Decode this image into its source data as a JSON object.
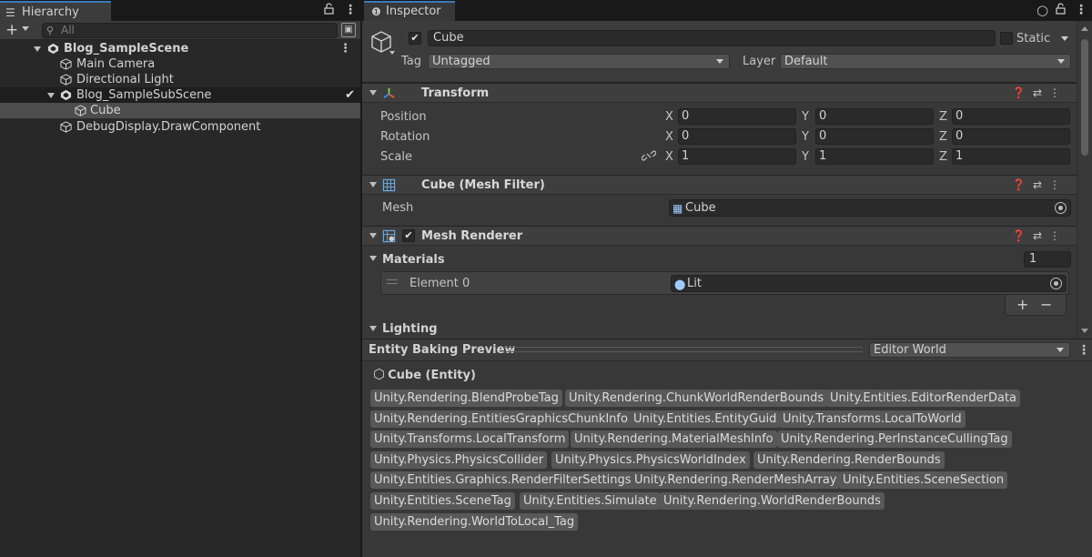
{
  "hierarchy": {
    "tab_label": "Hierarchy",
    "search_placeholder": "All",
    "items": [
      {
        "label": "Blog_SampleScene",
        "kind": "scene"
      },
      {
        "label": "Main Camera",
        "kind": "gameobject"
      },
      {
        "label": "Directional Light",
        "kind": "gameobject"
      },
      {
        "label": "Blog_SampleSubScene",
        "kind": "subscene"
      },
      {
        "label": "Cube",
        "kind": "gameobject",
        "selected": true
      },
      {
        "label": "DebugDisplay.DrawComponent",
        "kind": "gameobject"
      }
    ]
  },
  "inspector": {
    "tab_label": "Inspector",
    "object_name": "Cube",
    "static_label": "Static",
    "tag_label": "Tag",
    "tag_value": "Untagged",
    "layer_label": "Layer",
    "layer_value": "Default"
  },
  "transform": {
    "title": "Transform",
    "rows": [
      {
        "label": "Position",
        "x": "0",
        "y": "0",
        "z": "0"
      },
      {
        "label": "Rotation",
        "x": "0",
        "y": "0",
        "z": "0"
      },
      {
        "label": "Scale",
        "x": "1",
        "y": "1",
        "z": "1"
      }
    ],
    "axis_x": "X",
    "axis_y": "Y",
    "axis_z": "Z"
  },
  "mesh_filter": {
    "title": "Cube (Mesh Filter)",
    "mesh_label": "Mesh",
    "mesh_value": "Cube"
  },
  "mesh_renderer": {
    "title": "Mesh Renderer",
    "materials_label": "Materials",
    "materials_count": "1",
    "element_label": "Element 0",
    "element_value": "Lit",
    "plus": "+",
    "minus": "−",
    "lighting_label": "Lighting"
  },
  "baking_preview": {
    "title": "Entity Baking Preview",
    "world_value": "Editor World",
    "entity_title": "Cube (Entity)",
    "tags": [
      "Unity.Rendering.BlendProbeTag",
      "Unity.Rendering.ChunkWorldRenderBounds",
      "Unity.Entities.EditorRenderData",
      "Unity.Rendering.EntitiesGraphicsChunkInfo",
      "Unity.Entities.EntityGuid",
      "Unity.Transforms.LocalToWorld",
      "Unity.Transforms.LocalTransform",
      "Unity.Rendering.MaterialMeshInfo",
      "Unity.Rendering.PerInstanceCullingTag",
      "Unity.Physics.PhysicsCollider",
      "Unity.Physics.PhysicsWorldIndex",
      "Unity.Rendering.RenderBounds",
      "Unity.Entities.Graphics.RenderFilterSettings",
      "Unity.Rendering.RenderMeshArray",
      "Unity.Entities.SceneSection",
      "Unity.Entities.SceneTag",
      "Unity.Entities.Simulate",
      "Unity.Rendering.WorldRenderBounds",
      "Unity.Rendering.WorldToLocal_Tag"
    ]
  },
  "icons": {
    "tab_hierarchy": "list-icon",
    "tab_inspector": "info-icon",
    "lock": "lock-icon",
    "menu": "kebab-menu-icon",
    "help": "help-icon",
    "presets": "sliders-icon",
    "constrain_scale": "link-icon",
    "object_picker": "target-icon"
  },
  "colors": {
    "accent": "#3a79bb",
    "selected_row": "#4d4d4d",
    "tag_chip": "#585858"
  }
}
